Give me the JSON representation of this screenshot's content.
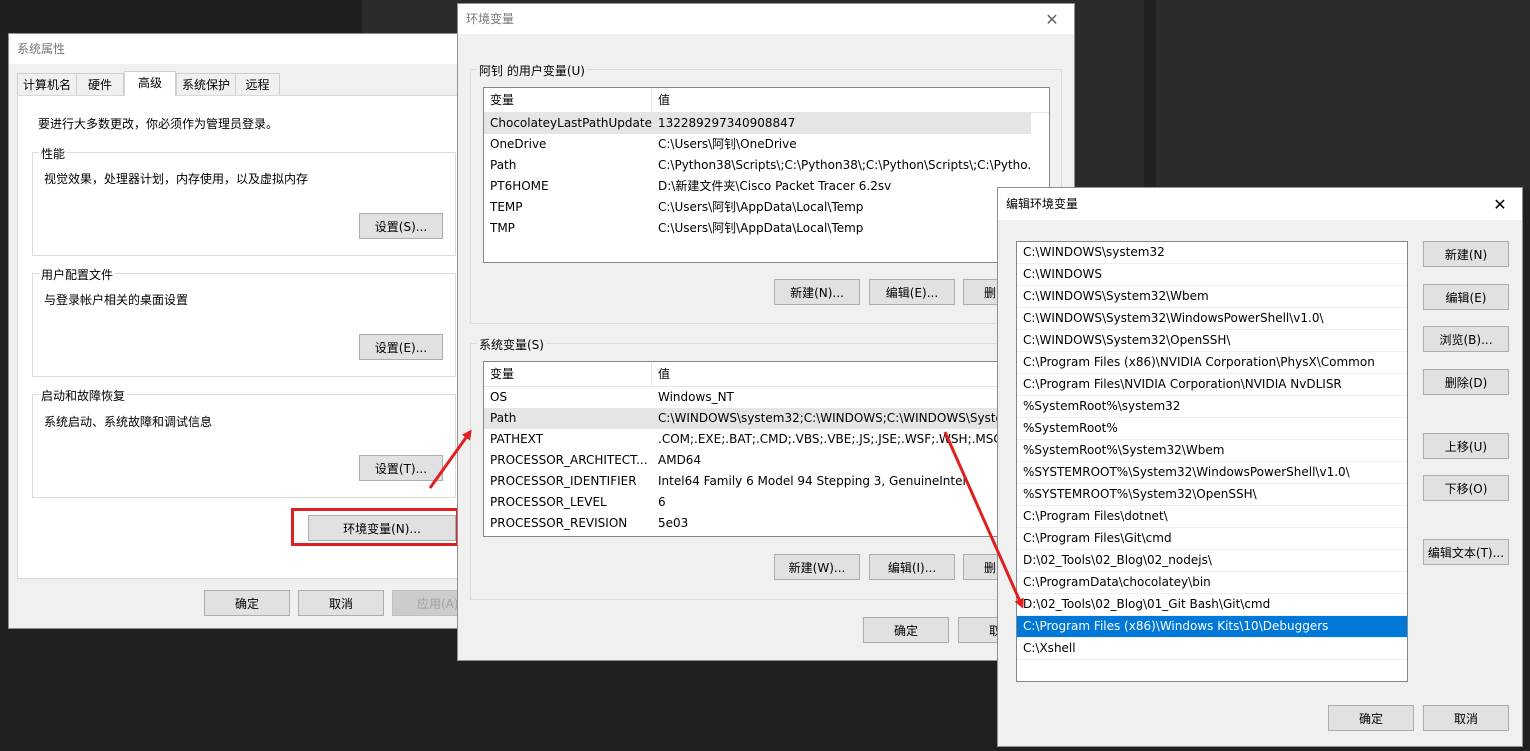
{
  "sysprop": {
    "title": "系统属性",
    "tabs": [
      {
        "label": "计算机名"
      },
      {
        "label": "硬件"
      },
      {
        "label": "高级"
      },
      {
        "label": "系统保护"
      },
      {
        "label": "远程"
      }
    ],
    "admin_note": "要进行大多数更改，你必须作为管理员登录。",
    "performance": {
      "label": "性能",
      "desc": "视觉效果，处理器计划，内存使用，以及虚拟内存",
      "button": "设置(S)..."
    },
    "profile": {
      "label": "用户配置文件",
      "desc": "与登录帐户相关的桌面设置",
      "button": "设置(E)..."
    },
    "startup": {
      "label": "启动和故障恢复",
      "desc": "系统启动、系统故障和调试信息",
      "button": "设置(T)..."
    },
    "env_button": "环境变量(N)...",
    "ok": "确定",
    "cancel": "取消",
    "apply": "应用(A)"
  },
  "envvars": {
    "title": "环境变量",
    "user_group_label": "阿钊 的用户变量(U)",
    "col_var": "变量",
    "col_val": "值",
    "user_vars": [
      {
        "name": "ChocolateyLastPathUpdate",
        "value": "132289297340908847"
      },
      {
        "name": "OneDrive",
        "value": "C:\\Users\\阿钊\\OneDrive"
      },
      {
        "name": "Path",
        "value": "C:\\Python38\\Scripts\\;C:\\Python38\\;C:\\Python\\Scripts\\;C:\\Pytho..."
      },
      {
        "name": "PT6HOME",
        "value": "D:\\新建文件夹\\Cisco Packet Tracer 6.2sv"
      },
      {
        "name": "TEMP",
        "value": "C:\\Users\\阿钊\\AppData\\Local\\Temp"
      },
      {
        "name": "TMP",
        "value": "C:\\Users\\阿钊\\AppData\\Local\\Temp"
      }
    ],
    "user_new": "新建(N)...",
    "user_edit": "编辑(E)...",
    "user_delete": "删",
    "sys_group_label": "系统变量(S)",
    "sys_vars": [
      {
        "name": "OS",
        "value": "Windows_NT"
      },
      {
        "name": "Path",
        "value": "C:\\WINDOWS\\system32;C:\\WINDOWS;C:\\WINDOWS\\Syste"
      },
      {
        "name": "PATHEXT",
        "value": ".COM;.EXE;.BAT;.CMD;.VBS;.VBE;.JS;.JSE;.WSF;.WSH;.MSC"
      },
      {
        "name": "PROCESSOR_ARCHITECT...",
        "value": "AMD64"
      },
      {
        "name": "PROCESSOR_IDENTIFIER",
        "value": "Intel64 Family 6 Model 94 Stepping 3, GenuineIntel"
      },
      {
        "name": "PROCESSOR_LEVEL",
        "value": "6"
      },
      {
        "name": "PROCESSOR_REVISION",
        "value": "5e03"
      }
    ],
    "sys_new": "新建(W)...",
    "sys_edit": "编辑(I)...",
    "sys_delete": "删",
    "ok": "确定",
    "cancel": "取"
  },
  "editenv": {
    "title": "编辑环境变量",
    "paths": [
      "C:\\WINDOWS\\system32",
      "C:\\WINDOWS",
      "C:\\WINDOWS\\System32\\Wbem",
      "C:\\WINDOWS\\System32\\WindowsPowerShell\\v1.0\\",
      "C:\\WINDOWS\\System32\\OpenSSH\\",
      "C:\\Program Files (x86)\\NVIDIA Corporation\\PhysX\\Common",
      "C:\\Program Files\\NVIDIA Corporation\\NVIDIA NvDLISR",
      "%SystemRoot%\\system32",
      "%SystemRoot%",
      "%SystemRoot%\\System32\\Wbem",
      "%SYSTEMROOT%\\System32\\WindowsPowerShell\\v1.0\\",
      "%SYSTEMROOT%\\System32\\OpenSSH\\",
      "C:\\Program Files\\dotnet\\",
      "C:\\Program Files\\Git\\cmd",
      "D:\\02_Tools\\02_Blog\\02_nodejs\\",
      "C:\\ProgramData\\chocolatey\\bin",
      "D:\\02_Tools\\02_Blog\\01_Git Bash\\Git\\cmd",
      "C:\\Program Files (x86)\\Windows Kits\\10\\Debuggers",
      "C:\\Xshell"
    ],
    "new": "新建(N)",
    "edit": "编辑(E)",
    "browse": "浏览(B)...",
    "delete": "删除(D)",
    "move_up": "上移(U)",
    "move_down": "下移(O)",
    "edit_text": "编辑文本(T)...",
    "ok": "确定",
    "cancel": "取消"
  },
  "colors": {
    "highlight_red": "#e02020",
    "selection_blue": "#0078d7"
  },
  "icons": {
    "close": "close-icon",
    "arrow": "red-arrow-icon"
  }
}
